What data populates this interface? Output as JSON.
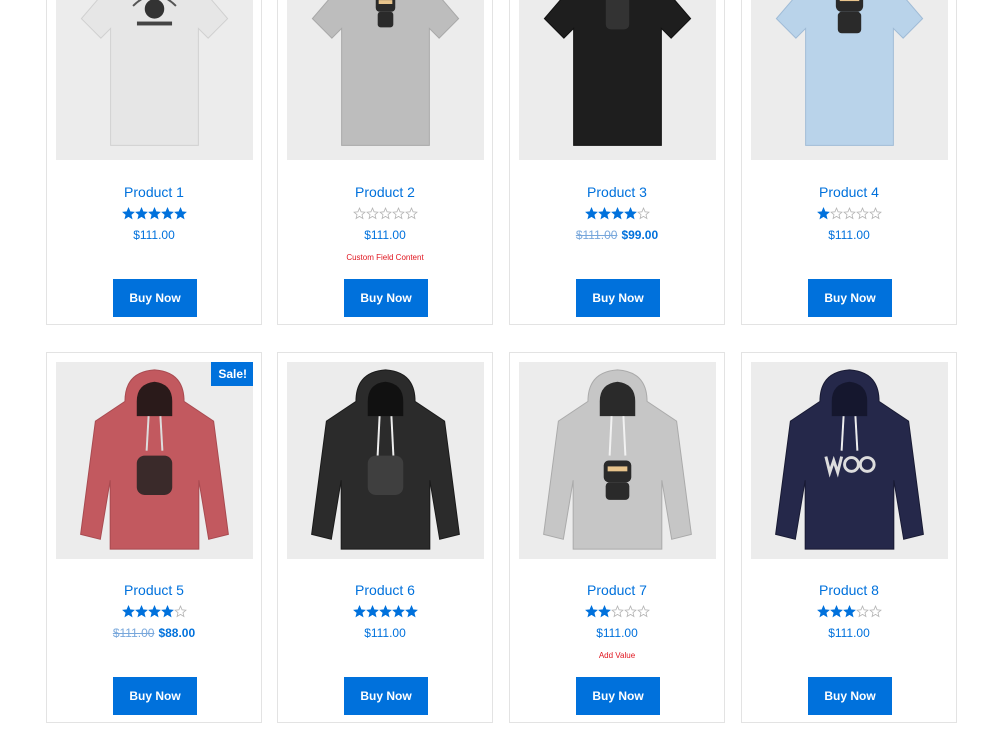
{
  "colors": {
    "accent": "#0071dc",
    "custom_text": "#e0151f",
    "image_bg": "#ececec"
  },
  "products": [
    {
      "title": "Product 1",
      "rating": 5,
      "price": "$111.00",
      "sale_badge": "",
      "custom_field": "",
      "button": "Buy Now",
      "image": "white-tshirt-woothemes-logo"
    },
    {
      "title": "Product 2",
      "rating": 0,
      "price": "$111.00",
      "sale_badge": "",
      "custom_field": "Custom Field Content",
      "button": "Buy Now",
      "image": "grey-tshirt-ninja"
    },
    {
      "title": "Product 3",
      "rating": 4,
      "old_price": "$111.00",
      "price": "$99.00",
      "sale_badge": "",
      "custom_field": "",
      "button": "Buy Now",
      "image": "black-tshirt-ninja"
    },
    {
      "title": "Product 4",
      "rating": 1,
      "price": "$111.00",
      "sale_badge": "",
      "custom_field": "",
      "button": "Buy Now",
      "image": "light-blue-tshirt-ninja"
    },
    {
      "title": "Product 5",
      "rating": 4,
      "old_price": "$111.00",
      "price": "$88.00",
      "sale_badge": "Sale!",
      "custom_field": "",
      "button": "Buy Now",
      "image": "red-hoodie-ninja"
    },
    {
      "title": "Product 6",
      "rating": 5,
      "price": "$111.00",
      "sale_badge": "",
      "custom_field": "",
      "button": "Buy Now",
      "image": "black-hoodie-ninja"
    },
    {
      "title": "Product 7",
      "rating": 2,
      "price": "$111.00",
      "sale_badge": "",
      "custom_field": "Add Value",
      "button": "Buy Now",
      "image": "grey-hoodie-ninja"
    },
    {
      "title": "Product 8",
      "rating": 3,
      "price": "$111.00",
      "sale_badge": "",
      "custom_field": "",
      "button": "Buy Now",
      "image": "navy-hoodie-woo-logo"
    }
  ]
}
